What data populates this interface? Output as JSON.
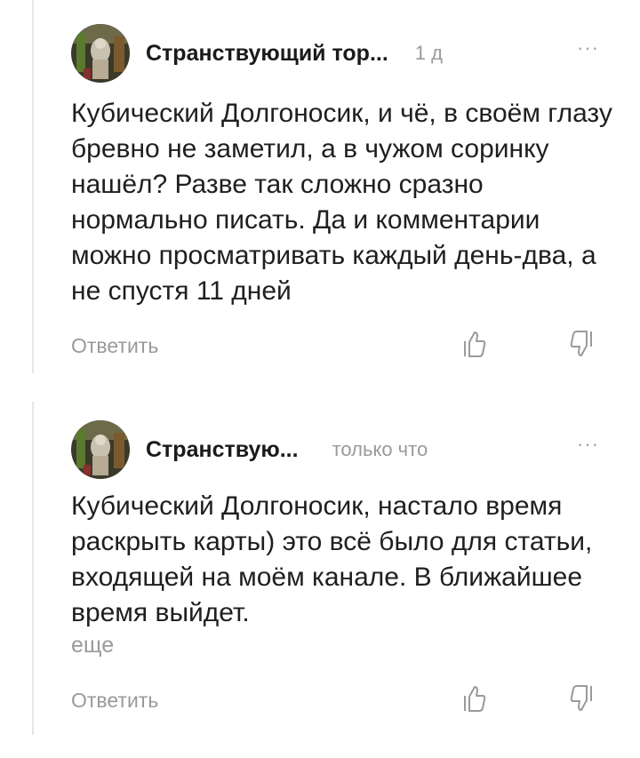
{
  "comments": [
    {
      "author": "Странствующий тор...",
      "time": "1 д",
      "more_icon": "more-horizontal-icon",
      "text": "Кубический Долгоносик, и чё, в своём глазу бревно не заметил, а в чужом соринку нашёл? Разве так сложно сразно нормально писать. Да и комментарии можно просматривать каждый день-два, а не спустя 11 дней",
      "reply_label": "Ответить",
      "like_icon": "thumbs-up-icon",
      "dislike_icon": "thumbs-down-icon"
    },
    {
      "author": "Странствую...",
      "time": "только что",
      "more_icon": "more-horizontal-icon",
      "text": "Кубический Долгоносик, настало время раскрыть карты) это всё было для статьи, входящей на моём канале. В ближайшее время выйдет.",
      "expand_label": "еще",
      "reply_label": "Ответить",
      "like_icon": "thumbs-up-icon",
      "dislike_icon": "thumbs-down-icon"
    }
  ]
}
